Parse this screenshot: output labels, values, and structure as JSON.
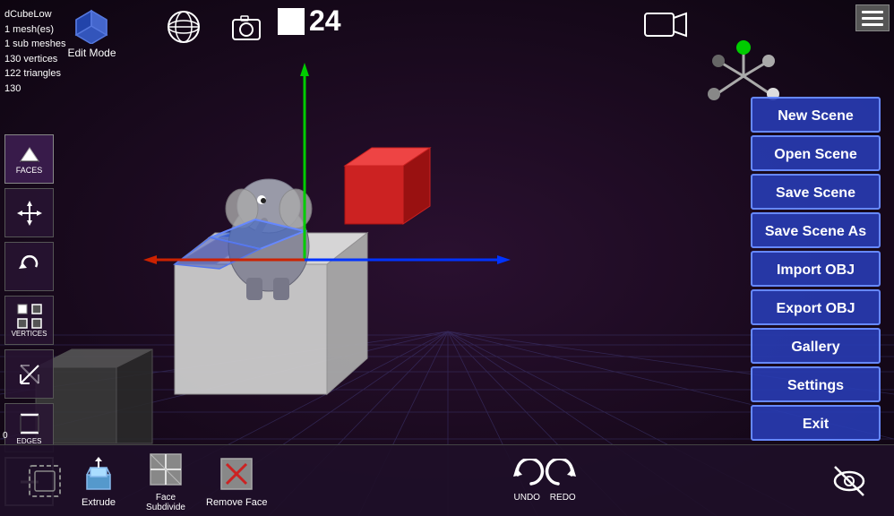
{
  "viewport": {
    "background": "#1a0818"
  },
  "top_left_info": {
    "object_name": "dCubeLow",
    "mesh_count": "1 mesh(es)",
    "sub_meshes": "1 sub meshes",
    "vertices": "130 vertices",
    "triangles": "122 triangles",
    "extra": "130"
  },
  "edit_mode": {
    "label": "Edit Mode"
  },
  "fps": {
    "value": "24"
  },
  "right_menu": {
    "items": [
      {
        "id": "new-scene",
        "label": "New Scene"
      },
      {
        "id": "open-scene",
        "label": "Open Scene"
      },
      {
        "id": "save-scene",
        "label": "Save Scene"
      },
      {
        "id": "save-scene-as",
        "label": "Save Scene As"
      },
      {
        "id": "import-obj",
        "label": "Import OBJ"
      },
      {
        "id": "export-obj",
        "label": "Export OBJ"
      },
      {
        "id": "gallery",
        "label": "Gallery"
      },
      {
        "id": "settings",
        "label": "Settings"
      },
      {
        "id": "exit",
        "label": "Exit"
      }
    ]
  },
  "left_tools": {
    "items": [
      {
        "id": "faces",
        "label": "FACES",
        "active": true
      },
      {
        "id": "move",
        "label": ""
      },
      {
        "id": "undo-rotate",
        "label": ""
      },
      {
        "id": "vertices",
        "label": "VERTICES"
      },
      {
        "id": "scale",
        "label": ""
      },
      {
        "id": "edges",
        "label": "EDGES"
      },
      {
        "id": "add",
        "label": ""
      }
    ]
  },
  "bottom_toolbar": {
    "tools": [
      {
        "id": "panel-left",
        "label": ""
      },
      {
        "id": "extrude",
        "label": "Extrude"
      },
      {
        "id": "face-subdivide",
        "label": "Face\nSubdivide"
      },
      {
        "id": "remove-face",
        "label": "Remove Face"
      }
    ],
    "undo_label": "UNDO",
    "redo_label": "REDO",
    "hide_label": ""
  },
  "status_bar": {
    "coordinate": "0"
  },
  "colors": {
    "menu_bg": "rgba(40,60,180,0.9)",
    "menu_border": "#6688ff",
    "toolbar_bg": "rgba(30,15,40,0.92)",
    "axis_x": "#cc2200",
    "axis_y": "#00aa00",
    "axis_z": "#0033cc"
  }
}
